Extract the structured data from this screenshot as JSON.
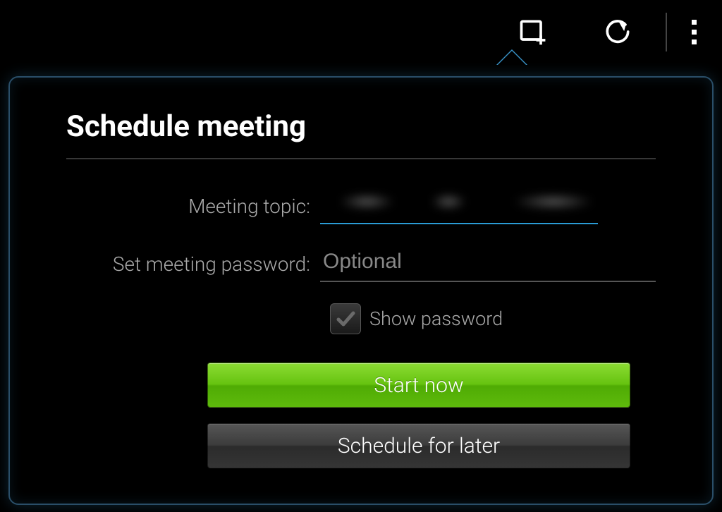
{
  "panel": {
    "title": "Schedule meeting"
  },
  "form": {
    "topic_label": "Meeting topic:",
    "topic_value": "",
    "password_label": "Set meeting password:",
    "password_value": "",
    "password_placeholder": "Optional",
    "show_password_label": "Show password"
  },
  "buttons": {
    "start_now": "Start now",
    "schedule_later": "Schedule for later"
  }
}
